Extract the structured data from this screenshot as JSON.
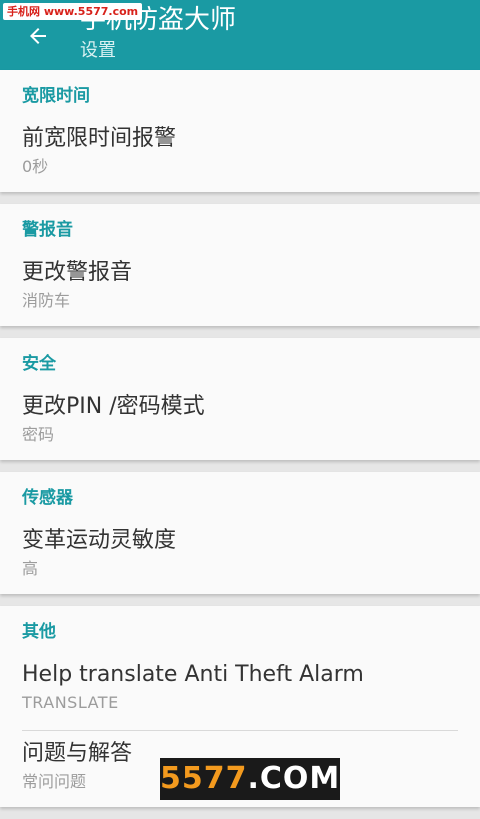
{
  "appbar": {
    "title": "手机防盗大师",
    "subtitle": "设置",
    "back_icon": "arrow-left-icon",
    "color": "#1a9aa3"
  },
  "watermarks": {
    "top": "手机网 www.5577.com",
    "bottom_accent": "5577",
    "bottom_rest": ".COM"
  },
  "sections": [
    {
      "header": "宽限时间",
      "items": [
        {
          "title": "前宽限时间报警",
          "summary": "0秒"
        }
      ]
    },
    {
      "header": "警报音",
      "items": [
        {
          "title": "更改警报音",
          "summary": "消防车"
        }
      ]
    },
    {
      "header": "安全",
      "items": [
        {
          "title": "更改PIN /密码模式",
          "summary": "密码"
        }
      ]
    },
    {
      "header": "传感器",
      "items": [
        {
          "title": "变革运动灵敏度",
          "summary": "高"
        }
      ]
    },
    {
      "header": "其他",
      "items": [
        {
          "title": "Help translate Anti Theft Alarm",
          "summary": "TRANSLATE"
        },
        {
          "title": "问题与解答",
          "summary": "常问问题"
        }
      ]
    }
  ]
}
